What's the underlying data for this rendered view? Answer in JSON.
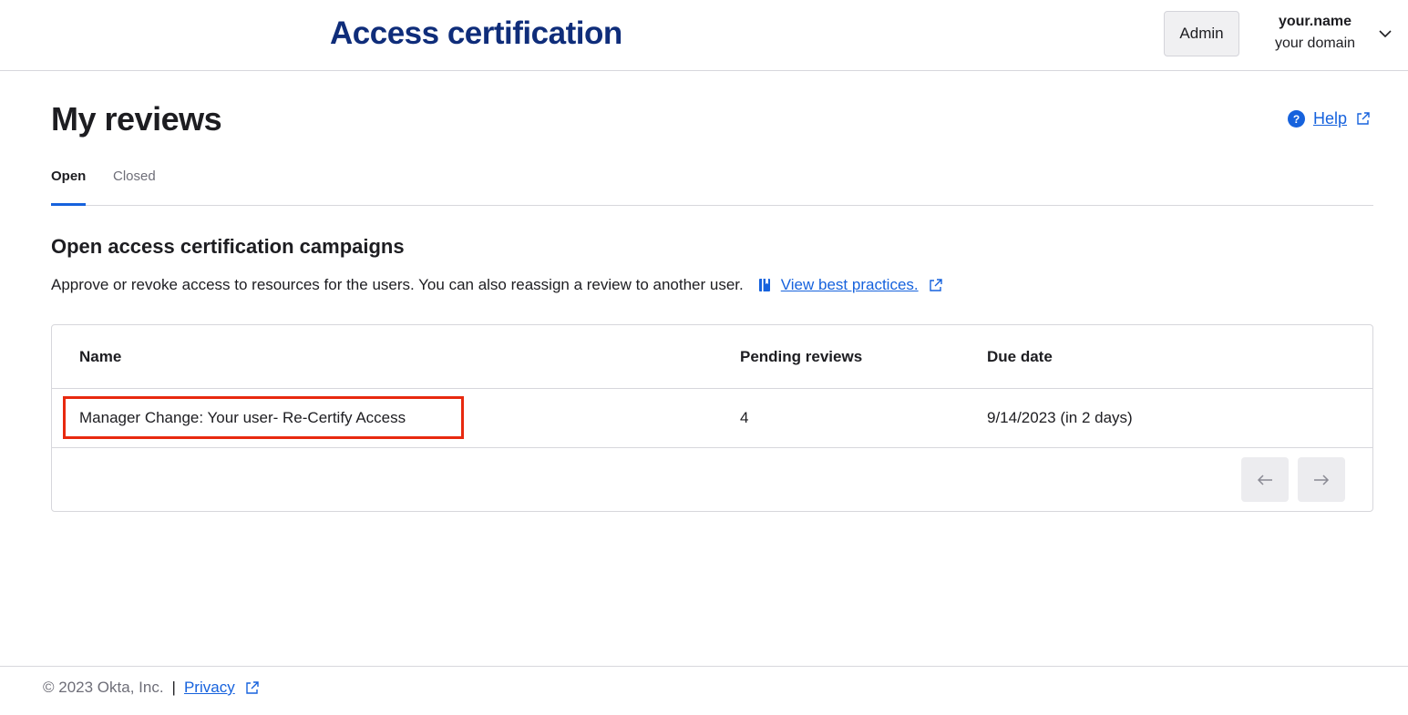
{
  "header": {
    "app_title": "Access certification",
    "admin_label": "Admin",
    "user_name": "your.name",
    "user_domain": "your domain"
  },
  "page": {
    "title": "My reviews",
    "help_label": "Help"
  },
  "tabs": [
    {
      "label": "Open",
      "selected": true
    },
    {
      "label": "Closed",
      "selected": false
    }
  ],
  "section": {
    "title": "Open access certification campaigns",
    "description": "Approve or revoke access to resources for the users. You can also reassign a review to another user.",
    "best_practices_label": "View best practices."
  },
  "table": {
    "columns": [
      "Name",
      "Pending reviews",
      "Due date"
    ],
    "rows": [
      {
        "name": "Manager Change: Your user- Re-Certify Access",
        "pending": "4",
        "due": "9/14/2023 (in 2 days)"
      }
    ]
  },
  "footer": {
    "copyright": "© 2023 Okta, Inc.",
    "separator": "|",
    "privacy_label": "Privacy"
  },
  "colors": {
    "brand_title": "#0f2d7a",
    "link": "#1662dd",
    "highlight": "#e8290f"
  },
  "icons": [
    "chevron-down-icon",
    "help-circle-icon",
    "external-link-icon",
    "book-icon",
    "arrow-left-icon",
    "arrow-right-icon"
  ]
}
